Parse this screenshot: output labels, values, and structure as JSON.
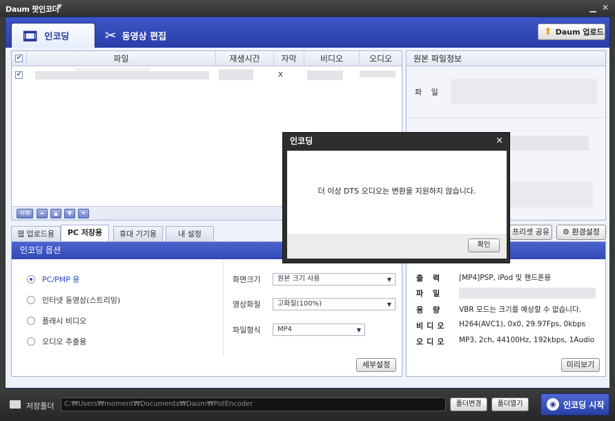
{
  "window": {
    "title": "Daum 팟인코더",
    "menu_icon": "chevron-down-icon",
    "minimize": "▁",
    "close": "✕"
  },
  "main_tabs": [
    {
      "label": "인코딩",
      "icon": "film-reel-icon",
      "active": true
    },
    {
      "label": "동영상 편집",
      "icon": "scissors-icon",
      "active": false
    }
  ],
  "upload_button": {
    "label": "Daum 업로드",
    "icon": "up-arrow-icon"
  },
  "file_list": {
    "columns": [
      "파일",
      "재생시간",
      "자막",
      "비디오",
      "오디오"
    ],
    "rows": [
      {
        "checked": true,
        "subtitle": "x"
      }
    ],
    "tools": {
      "delete": "삭제"
    }
  },
  "info_panel": {
    "title": "원본 파일정보",
    "file_label": "파 일"
  },
  "sub_tabs": [
    "웹 업로드용",
    "PC 저장용",
    "휴대 기기용",
    "내 설정"
  ],
  "active_sub_tab": 1,
  "preset_share": "프리셋 공유",
  "settings_button": "환경설정",
  "options": {
    "title": "인코딩 옵션",
    "radios": [
      "PC/PMP 용",
      "인터넷 동영상(스트리밍)",
      "플래시 비디오",
      "오디오 추출용"
    ],
    "selected_radio": 0,
    "fields": [
      {
        "label": "화면크기",
        "value": "원본 크기 사용"
      },
      {
        "label": "영상화질",
        "value": "고화질(100%)"
      },
      {
        "label": "파일형식",
        "value": "MP4"
      }
    ],
    "detail_button": "세부설정"
  },
  "output": {
    "rows": [
      {
        "key": "출 력",
        "value": "[MP4]PSP, iPod 및 핸드폰용"
      },
      {
        "key": "파 일",
        "value": ""
      },
      {
        "key": "용 량",
        "value": "VBR 모드는 크기를 예상할 수 없습니다."
      },
      {
        "key": "비디오",
        "value": "H264(AVC1), 0x0, 29.97Fps, 0kbps"
      },
      {
        "key": "오디오",
        "value": "MP3, 2ch, 44100Hz, 192kbps, 1Audio"
      }
    ],
    "preview_button": "미리보기"
  },
  "bottom": {
    "folder_label": "저장폴더",
    "path": "C:₩Users₩moment₩Documents₩Daum₩PotEncoder",
    "change_folder": "폴더변경",
    "open_folder": "폴더열기",
    "start": "인코딩 시작"
  },
  "dialog": {
    "title": "인코딩",
    "message": "더 이상 DTS 오디오는 변환을 지원하지 않습니다.",
    "ok": "확인"
  },
  "colors": {
    "accent": "#3149b4",
    "selected_text": "#2b4cc4"
  }
}
